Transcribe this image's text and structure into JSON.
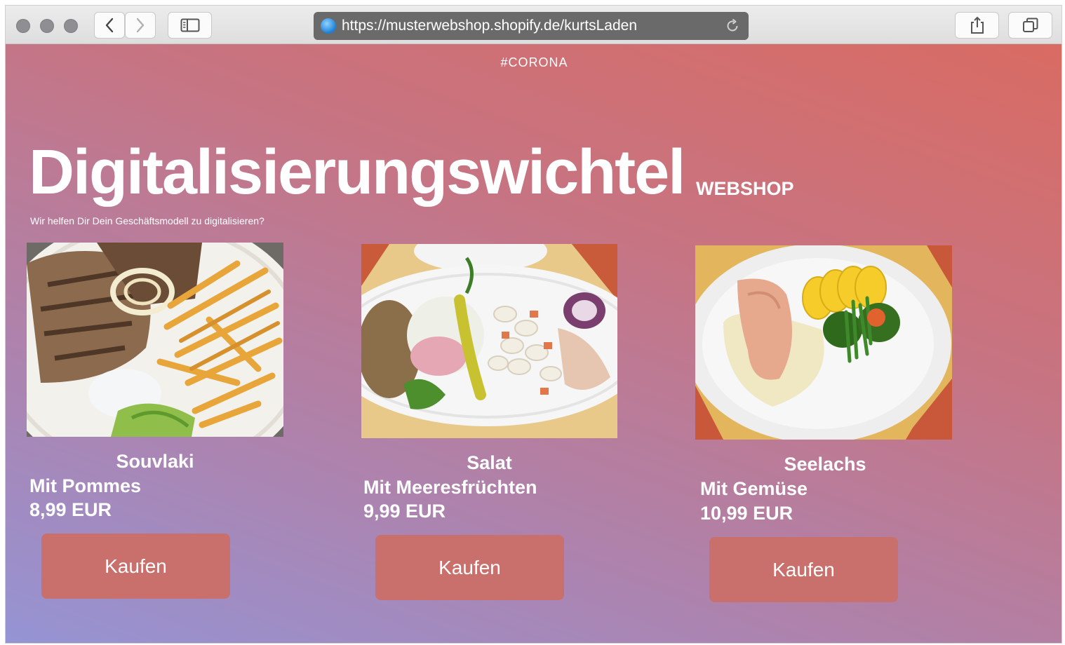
{
  "browser": {
    "url": "https://musterwebshop.shopify.de/kurtsLaden"
  },
  "page": {
    "hashtag": "#CORONA",
    "title": "Digitalisierungswichtel",
    "title_suffix": "WEBSHOP",
    "tagline": "Wir helfen Dir Dein Geschäftsmodell zu digitalisieren?"
  },
  "products": [
    {
      "name": "Souvlaki",
      "description": "Mit Pommes",
      "price": "8,99 EUR",
      "button": "Kaufen"
    },
    {
      "name": "Salat",
      "description": "Mit Meeresfrüchten",
      "price": "9,99 EUR",
      "button": "Kaufen"
    },
    {
      "name": "Seelachs",
      "description": "Mit Gemüse",
      "price": "10,99 EUR",
      "button": "Kaufen"
    }
  ],
  "colors": {
    "button": "#c96f6c",
    "gradient_top_right": "#d96b63",
    "gradient_bottom_left": "#9594d4"
  }
}
